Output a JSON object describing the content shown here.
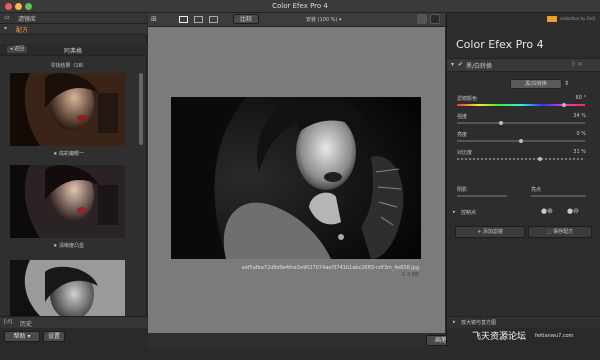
{
  "window": {
    "title": "Color Efex Pro 4",
    "lights": [
      "#ee5f57",
      "#f5bd4f",
      "#61c554"
    ]
  },
  "left": {
    "filters_tab": "滤镜库",
    "recipes_tab": "配方",
    "back_label": "返回",
    "nav_title": "阿弗格",
    "results_title": "寻找结果（18）",
    "thumbs": [
      {
        "caption": "★ 炫彩魔眼一"
      },
      {
        "caption": "★ 清晰度凸显"
      },
      {
        "caption": ""
      }
    ],
    "history_label": "历史",
    "help_label": "帮助",
    "settings_label": "设置"
  },
  "toolbar": {
    "compare_label": "比较",
    "zoom_label": "安装 (100 %)"
  },
  "image": {
    "filename": "aef5afba72d8d9e4fce2e9027074aef3741b1abc26ff3-rzlf3m_fw658.jpg",
    "size": "0.3 MP"
  },
  "center_bottom": {
    "save_label": "画笔"
  },
  "right": {
    "app_title": "Color Efex Pro",
    "app_version": "4",
    "nik_text": "collection by DxO",
    "filter_name": "黑/白转换",
    "dropdown_value": "黑/白转换",
    "sliders": [
      {
        "label": "滤镜颜色",
        "value": "60 °",
        "level": 0.85,
        "rainbow": true
      },
      {
        "label": "强度",
        "value": "34 %",
        "level": 0.34
      },
      {
        "label": "亮度",
        "value": "0 %",
        "level": 0.5
      },
      {
        "label": "对比度",
        "value": "31 %",
        "level": 0.65
      }
    ],
    "shadows_label": "阴影",
    "highlights_label": "亮点",
    "control_points_label": "控制点",
    "add_filter_label": "添加滤镜",
    "save_recipe_label": "保存配方",
    "loupe_label": "放大镜与直方图"
  },
  "watermark": {
    "site_name": "飞天资源论坛",
    "site_url": "feitianwu7.com"
  }
}
